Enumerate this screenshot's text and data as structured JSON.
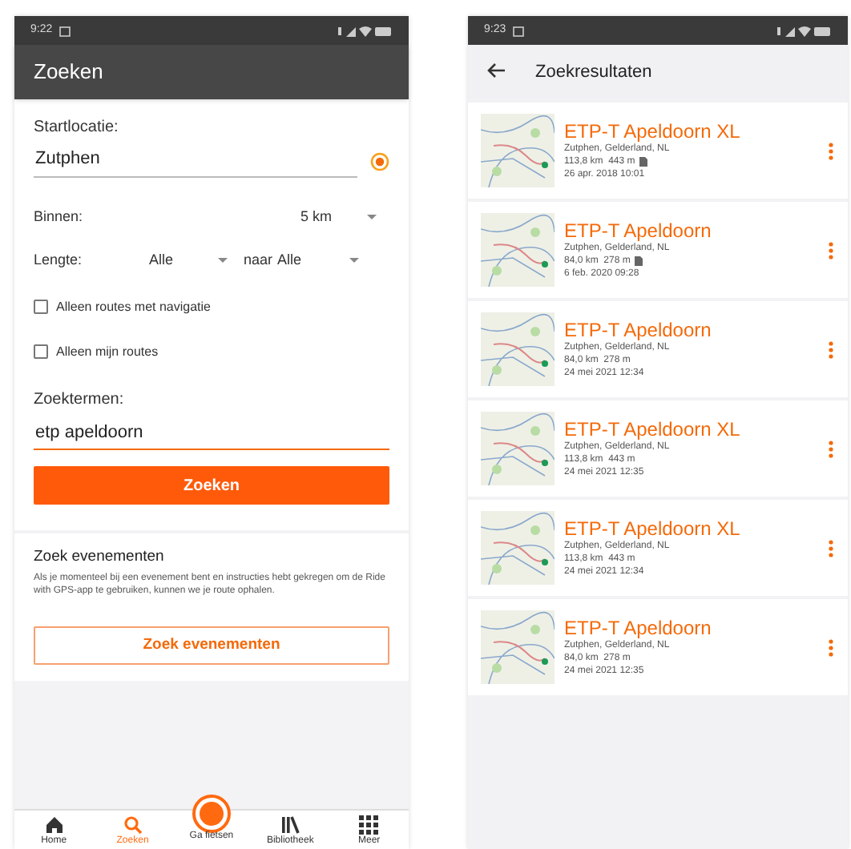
{
  "search_screen": {
    "status_bar": {
      "time": "9:22"
    },
    "title": "Zoeken",
    "start_label": "Startlocatie:",
    "start_value": "Zutphen",
    "within": {
      "label": "Binnen:",
      "value": "5 km"
    },
    "length": {
      "label": "Lengte:",
      "from": "Alle",
      "to_label": "naar",
      "to": "Alle"
    },
    "checkboxes": [
      {
        "label": "Alleen routes met navigatie",
        "checked": false
      },
      {
        "label": "Alleen mijn routes",
        "checked": false
      }
    ],
    "terms_label": "Zoektermen:",
    "terms_value": "etp apeldoorn",
    "search_button": "Zoeken",
    "events": {
      "title": "Zoek evenementen",
      "text": "Als je momenteel bij een evenement bent en instructies hebt gekregen om de Ride with GPS-app te gebruiken, kunnen we je route ophalen.",
      "button": "Zoek evenementen"
    },
    "nav": [
      {
        "kind": "home",
        "label": "Home",
        "selected": false
      },
      {
        "kind": "search",
        "label": "Zoeken",
        "selected": true
      },
      {
        "kind": "ride",
        "label": "Ga fietsen",
        "selected": false
      },
      {
        "kind": "library",
        "label": "Bibliotheek",
        "selected": false
      },
      {
        "kind": "more",
        "label": "Meer",
        "selected": false
      }
    ]
  },
  "results_screen": {
    "status_bar": {
      "time": "9:23"
    },
    "title": "Zoekresultaten",
    "results": [
      {
        "title": "ETP-T Apeldoorn XL",
        "location": "Zutphen, Gelderland, NL",
        "stats": "113,8 km  443 m",
        "file": true,
        "date": "26 apr. 2018 10:01"
      },
      {
        "title": "ETP-T Apeldoorn",
        "location": "Zutphen, Gelderland, NL",
        "stats": "84,0 km  278 m",
        "file": true,
        "date": "6 feb. 2020 09:28"
      },
      {
        "title": "ETP-T Apeldoorn",
        "location": "Zutphen, Gelderland, NL",
        "stats": "84,0 km  278 m",
        "file": false,
        "date": "24 mei 2021 12:34"
      },
      {
        "title": "ETP-T Apeldoorn XL",
        "location": "Zutphen, Gelderland, NL",
        "stats": "113,8 km  443 m",
        "file": false,
        "date": "24 mei 2021 12:35"
      },
      {
        "title": "ETP-T Apeldoorn XL",
        "location": "Zutphen, Gelderland, NL",
        "stats": "113,8 km  443 m",
        "file": false,
        "date": "24 mei 2021 12:34"
      },
      {
        "title": "ETP-T Apeldoorn",
        "location": "Zutphen, Gelderland, NL",
        "stats": "84,0 km  278 m",
        "file": false,
        "date": "24 mei 2021 12:35"
      }
    ]
  }
}
